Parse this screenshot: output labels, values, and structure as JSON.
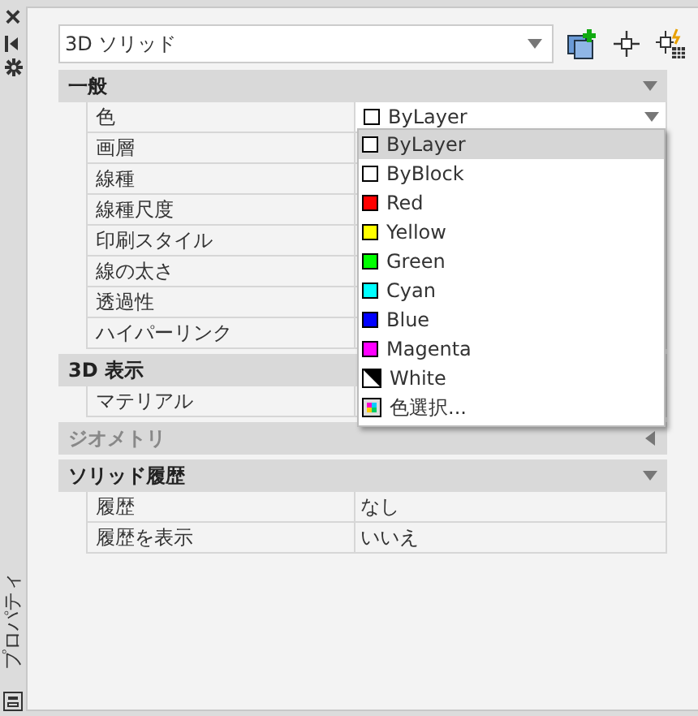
{
  "side_bar": {
    "close": "×",
    "title": "プロパティ"
  },
  "object_select": {
    "value": "3D ソリッド"
  },
  "sections": [
    {
      "title": "一般",
      "expanded": true,
      "rows": [
        {
          "label": "色",
          "value": "ByLayer",
          "dropdown": true
        },
        {
          "label": "画層"
        },
        {
          "label": "線種"
        },
        {
          "label": "線種尺度"
        },
        {
          "label": "印刷スタイル"
        },
        {
          "label": "線の太さ"
        },
        {
          "label": "透過性"
        },
        {
          "label": "ハイパーリンク"
        }
      ]
    },
    {
      "title": "3D 表示",
      "expanded": true,
      "rows": [
        {
          "label": "マテリアル"
        }
      ]
    },
    {
      "title": "ジオメトリ",
      "expanded": false
    },
    {
      "title": "ソリッド履歴",
      "expanded": true,
      "rows": [
        {
          "label": "履歴",
          "value": "なし"
        },
        {
          "label": "履歴を表示",
          "value": "いいえ"
        }
      ]
    }
  ],
  "color_list": [
    {
      "label": "ByLayer",
      "kind": "plain",
      "selected": true
    },
    {
      "label": "ByBlock",
      "kind": "plain",
      "selected": false
    },
    {
      "label": "Red",
      "kind": "solid",
      "color": "#ff0000",
      "selected": false
    },
    {
      "label": "Yellow",
      "kind": "solid",
      "color": "#ffff00",
      "selected": false
    },
    {
      "label": "Green",
      "kind": "solid",
      "color": "#00ff00",
      "selected": false
    },
    {
      "label": "Cyan",
      "kind": "solid",
      "color": "#00ffff",
      "selected": false
    },
    {
      "label": "Blue",
      "kind": "solid",
      "color": "#0000ff",
      "selected": false
    },
    {
      "label": "Magenta",
      "kind": "solid",
      "color": "#ff00ff",
      "selected": false
    },
    {
      "label": "White",
      "kind": "split",
      "selected": false
    },
    {
      "label": "色選択...",
      "kind": "palette",
      "selected": false
    }
  ]
}
